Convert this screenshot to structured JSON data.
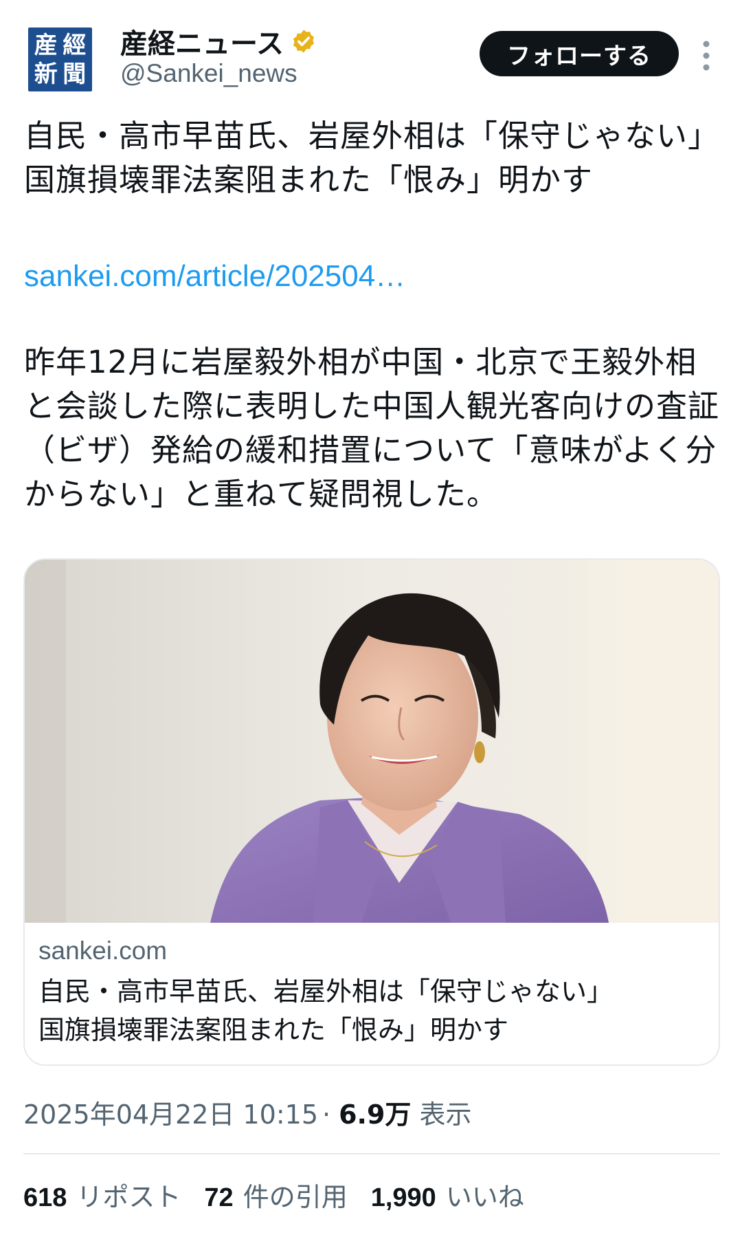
{
  "account": {
    "avatar_chars": [
      "産",
      "經",
      "新",
      "聞"
    ],
    "display_name": "産経ニュース",
    "handle": "@Sankei_news",
    "verified_icon": "gold-verified-badge",
    "follow_label": "フォローする",
    "more_icon": "vertical-ellipsis"
  },
  "tweet": {
    "title": "自民・高市早苗氏、岩屋外相は「保守じゃない」　国旗損壊罪法案阻まれた「恨み」明かす",
    "link": "sankei.com/article/202504…",
    "body": "昨年12月に岩屋毅外相が中国・北京で王毅外相と会談した際に表明した中国人観光客向けの査証（ビザ）発給の緩和措置について「意味がよく分からない」と重ねて疑問視した。"
  },
  "card": {
    "domain": "sankei.com",
    "title_line1": "自民・高市早苗氏、岩屋外相は「保守じゃない」",
    "title_line2": "国旗損壊罪法案阻まれた「恨み」明かす"
  },
  "meta": {
    "datetime": "2025年04月22日 10:15",
    "separator": "·",
    "views_count": "6.9万",
    "views_label": "表示"
  },
  "stats": {
    "reposts_count": "618",
    "reposts_label": "リポスト",
    "quotes_count": "72",
    "quotes_label": "件の引用",
    "likes_count": "1,990",
    "likes_label": "いいね"
  },
  "colors": {
    "text": "#0f1419",
    "secondary": "#536471",
    "link": "#1d9bf0",
    "follow_bg": "#0f1419",
    "verified": "#e8b21a",
    "avatar_bg": "#1d4e8f"
  }
}
